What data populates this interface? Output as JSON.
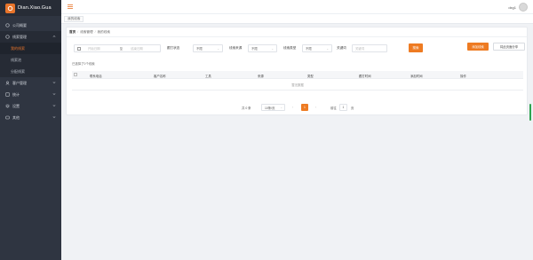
{
  "app": {
    "logo_text": "Dian.Xiao.Gua",
    "logo_badge": "点"
  },
  "sidebar": {
    "items": [
      {
        "label": "公司概要",
        "icon": "home-icon"
      },
      {
        "label": "线索管理",
        "icon": "grid-icon",
        "open": true,
        "children": [
          {
            "label": "我的线索",
            "active": true
          },
          {
            "label": "线索池"
          },
          {
            "label": "分配线索"
          }
        ]
      },
      {
        "label": "客户管理",
        "icon": "user-icon"
      },
      {
        "label": "统计",
        "icon": "chart-icon"
      },
      {
        "label": "设置",
        "icon": "gear-icon"
      },
      {
        "label": "其他",
        "icon": "other-icon"
      }
    ]
  },
  "header": {
    "user_name": "dxg1"
  },
  "tabbar": {
    "tab_label": "我的线索"
  },
  "breadcrumb": [
    "首页",
    "线索管理",
    "我的线索"
  ],
  "filters": {
    "start_placeholder": "开始日期",
    "to": "至",
    "end_placeholder": "结束日期",
    "follow_label": "跟打状态",
    "follow_value": "不限",
    "source_label": "线索来源",
    "source_value": "不限",
    "type_label": "线索类型",
    "type_value": "不限",
    "keyword_label": "关键词",
    "keyword_placeholder": "关键词",
    "search_label": "搜索"
  },
  "actions": {
    "add_label": "添加线索",
    "share_label": "将此页面分享"
  },
  "selected_note": "已选择了0个线索",
  "table": {
    "columns": [
      "联系电话",
      "客户名称",
      "工具",
      "来源",
      "类型",
      "跟打时间",
      "添加时间",
      "操作"
    ],
    "empty_text": "暂无数据"
  },
  "pagination": {
    "total": "共 0 条",
    "page_size": "10条/页",
    "prev": "‹",
    "current": "1",
    "next": "›",
    "goto_label": "前往",
    "goto_value": "1",
    "page_suffix": "页"
  },
  "colors": {
    "accent": "#ee7b22",
    "sidebar_bg": "#2f3541"
  }
}
